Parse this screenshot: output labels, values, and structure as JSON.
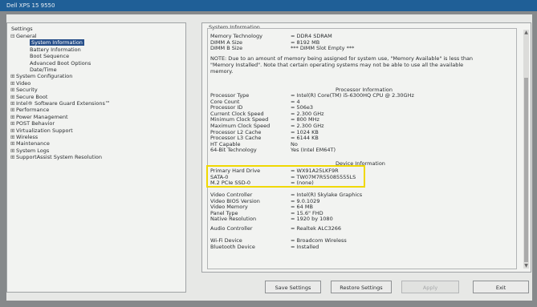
{
  "window": {
    "title": "Dell XPS 15 9550"
  },
  "left_pane": {
    "title": "Settings",
    "items": [
      {
        "label": "General",
        "expander": "⊟",
        "level": 1
      },
      {
        "label": "System Information",
        "level": 2,
        "selected": true
      },
      {
        "label": "Battery Information",
        "level": 2
      },
      {
        "label": "Boot Sequence",
        "level": 2
      },
      {
        "label": "Advanced Boot Options",
        "level": 2
      },
      {
        "label": "Date/Time",
        "level": 2
      },
      {
        "label": "System Configuration",
        "expander": "⊞",
        "level": 1
      },
      {
        "label": "Video",
        "expander": "⊞",
        "level": 1
      },
      {
        "label": "Security",
        "expander": "⊞",
        "level": 1
      },
      {
        "label": "Secure Boot",
        "expander": "⊞",
        "level": 1
      },
      {
        "label": "Intel® Software Guard Extensions™",
        "expander": "⊞",
        "level": 1
      },
      {
        "label": "Performance",
        "expander": "⊞",
        "level": 1
      },
      {
        "label": "Power Management",
        "expander": "⊞",
        "level": 1
      },
      {
        "label": "POST Behavior",
        "expander": "⊞",
        "level": 1
      },
      {
        "label": "Virtualization Support",
        "expander": "⊞",
        "level": 1
      },
      {
        "label": "Wireless",
        "expander": "⊞",
        "level": 1
      },
      {
        "label": "Maintenance",
        "expander": "⊞",
        "level": 1
      },
      {
        "label": "System Logs",
        "expander": "⊞",
        "level": 1
      },
      {
        "label": "SupportAssist System Resolution",
        "expander": "⊞",
        "level": 1
      }
    ]
  },
  "right_pane": {
    "title": "System Information",
    "memory_rows": [
      {
        "k": "Memory Technology",
        "v": "= DDR4 SDRAM"
      },
      {
        "k": "DIMM A Size",
        "v": "= 8192 MB"
      },
      {
        "k": "DIMM B Size",
        "v": "*** DIMM Slot Empty ***"
      }
    ],
    "memory_note": "NOTE: Due to an amount of memory being assigned for system use, \"Memory Available\" is less than \"Memory Installed\". Note that certain operating systems may not be able to use all the available memory.",
    "processor_heading": "Processor Information",
    "processor_rows": [
      {
        "k": "Processor Type",
        "v": "= Intel(R) Core(TM) i5-6300HQ CPU @ 2.30GHz"
      },
      {
        "k": "Core Count",
        "v": "= 4"
      },
      {
        "k": "Processor ID",
        "v": "= 506e3"
      },
      {
        "k": "Current Clock Speed",
        "v": "= 2.300 GHz"
      },
      {
        "k": "Minimum Clock Speed",
        "v": "= 800 MHz"
      },
      {
        "k": "Maximum Clock Speed",
        "v": "= 2.300 GHz"
      },
      {
        "k": "Processor L2 Cache",
        "v": "= 1024 KB"
      },
      {
        "k": "Processor L3 Cache",
        "v": "= 6144 KB"
      },
      {
        "k": "HT Capable",
        "v": "No"
      },
      {
        "k": "64-Bit Technology",
        "v": "Yes (Intel EM64T)"
      }
    ],
    "device_heading": "Device Information",
    "drive_rows": [
      {
        "k": "Primary Hard Drive",
        "v": "= WX91A25LKF9R"
      },
      {
        "k": "SATA-0",
        "v": "= TW07M7R55085555LS"
      },
      {
        "k": "M.2 PCIe SSD-0",
        "v": "= (none)"
      }
    ],
    "video_rows": [
      {
        "k": "Video Controller",
        "v": "= Intel(R) Skylake Graphics"
      },
      {
        "k": "Video BIOS Version",
        "v": "= 9.0.1029"
      },
      {
        "k": "Video Memory",
        "v": "= 64 MB"
      },
      {
        "k": "Panel Type",
        "v": "= 15.6\" FHD"
      },
      {
        "k": "Native Resolution",
        "v": "= 1920 by 1080"
      }
    ],
    "audio_rows": [
      {
        "k": "Audio Controller",
        "v": "= Realtek ALC3266"
      }
    ],
    "wireless_rows": [
      {
        "k": "Wi-Fi Device",
        "v": "= Broadcom Wireless"
      },
      {
        "k": "Bluetooth Device",
        "v": "= Installed"
      }
    ]
  },
  "buttons": {
    "save": "Save Settings",
    "restore": "Restore Settings",
    "apply": "Apply",
    "exit": "Exit"
  },
  "colors": {
    "highlight": "#f0d800",
    "selection": "#274f8a",
    "titlebar": "#1f5f97"
  }
}
